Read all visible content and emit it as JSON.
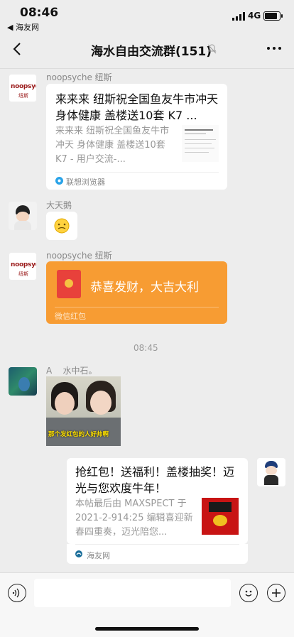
{
  "status_bar": {
    "time": "08:46",
    "back_app": "◀ 海友网",
    "network": "4G"
  },
  "nav": {
    "title": "海水自由交流群(151)"
  },
  "messages": [
    {
      "sender": "noopsyche 纽斯",
      "avatar_text_1": "noopsyche",
      "avatar_text_2": "纽斯",
      "card_title": "来来来 纽斯祝全国鱼友牛市冲天 身体健康 盖楼送10套 K7 ...",
      "card_desc": "来来来 纽斯祝全国鱼友牛市冲天 身体健康 盖楼送10套 K7 - 用户交流-...",
      "card_source": "联想浏览器"
    },
    {
      "sender": "大天鹅"
    },
    {
      "sender": "noopsyche 纽斯",
      "avatar_text_1": "noopsyche",
      "avatar_text_2": "纽斯",
      "red_packet_text": "恭喜发财，大吉大利",
      "red_packet_label": "微信红包"
    },
    {
      "timestamp": "08:45"
    },
    {
      "sender": "A    水中石。",
      "meme_caption": "那个发红包的人好帅啊"
    },
    {
      "card_title": "抢红包！送福利！盖楼抽奖！迈光与您欢度牛年！",
      "card_desc": "本帖最后由 MAXSPECT 于 2021-2-914:25 编辑喜迎新春四重奏，迈光陪您...",
      "card_source": "海友网"
    }
  ],
  "colors": {
    "red_packet": "#f79c33",
    "background": "#ededed"
  }
}
